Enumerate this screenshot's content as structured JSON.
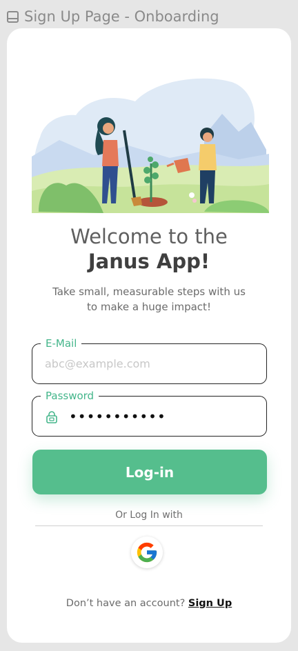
{
  "frame": {
    "title": "Sign Up Page - Onboarding",
    "icon": "frame-icon"
  },
  "welcome": {
    "line1": "Welcome to the",
    "line2": "Janus App!"
  },
  "subtitle": {
    "line1": "Take small, measurable steps with us",
    "line2": "to make a huge impact!"
  },
  "email": {
    "label": "E-Mail",
    "placeholder": "abc@example.com",
    "value": ""
  },
  "password": {
    "label": "Password",
    "masked_value": "•••••••••••",
    "icon": "lock-icon"
  },
  "login_button": {
    "label": "Log-in"
  },
  "alt_login": {
    "label": "Or Log In with",
    "provider": "google-icon"
  },
  "signup": {
    "prompt": "Don’t have an account?",
    "link": "Sign Up"
  },
  "colors": {
    "accent": "#55be8d",
    "accent_text": "#43b58a",
    "card": "#ffffff",
    "canvas": "#e6e6e6"
  }
}
